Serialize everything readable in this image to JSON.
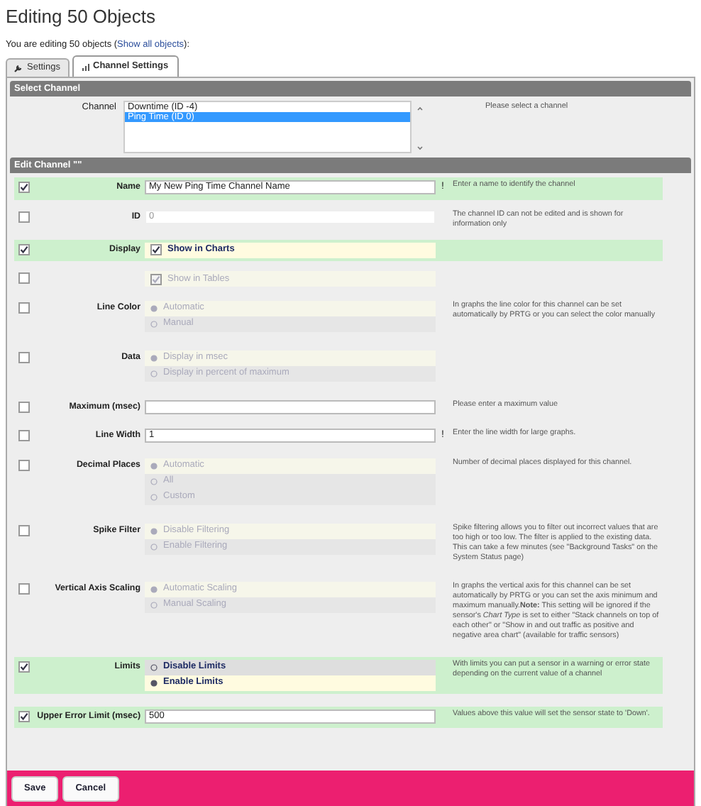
{
  "page_title": "Editing 50 Objects",
  "intro": {
    "before": "You are editing 50 objects (",
    "link": "Show all objects",
    "after": "):"
  },
  "tabs": [
    {
      "label": "Settings",
      "selected": false
    },
    {
      "label": "Channel Settings",
      "selected": true
    }
  ],
  "select_channel": {
    "title": "Select Channel",
    "label": "Channel",
    "help": "Please select a channel",
    "channels": [
      {
        "label": "Downtime (ID -4)",
        "selected": false
      },
      {
        "label": "Ping Time (ID 0)",
        "selected": true
      }
    ]
  },
  "edit_channel": {
    "title": "Edit Channel \"\"",
    "rows": [
      {
        "kind": "text",
        "label": "Name",
        "applied": true,
        "value": "My New Ping Time Channel Name",
        "mark": "!",
        "help": "Enter a name to identify the channel"
      },
      {
        "kind": "readonly",
        "label": "ID",
        "applied": false,
        "value": "0",
        "help": "The channel ID can not be edited and is shown for information only"
      },
      {
        "kind": "checkbox",
        "label": "Display",
        "applied": true,
        "option": "Show in Charts",
        "checked": true
      },
      {
        "kind": "checkbox",
        "applied": false,
        "option": "Show in Tables",
        "checked": true
      },
      {
        "kind": "radio",
        "label": "Line Color",
        "applied": false,
        "help": "In graphs the line color for this channel can be set automatically by PRTG or you can select the color manually",
        "options": [
          {
            "label": "Automatic",
            "selected": true
          },
          {
            "label": "Manual",
            "selected": false
          }
        ]
      },
      {
        "kind": "radio",
        "label": "Data",
        "applied": false,
        "options": [
          {
            "label": "Display in msec",
            "selected": true
          },
          {
            "label": "Display in percent of maximum",
            "selected": false
          }
        ]
      },
      {
        "kind": "text",
        "label": "Maximum (msec)",
        "applied": false,
        "help": "Please enter a maximum value"
      },
      {
        "kind": "text",
        "label": "Line Width",
        "applied": false,
        "value": "1",
        "mark": "!",
        "help": "Enter the line width for large graphs."
      },
      {
        "kind": "radio",
        "label": "Decimal Places",
        "applied": false,
        "help": "Number of decimal places displayed for this channel.",
        "options": [
          {
            "label": "Automatic",
            "selected": true
          },
          {
            "label": "All",
            "selected": false
          },
          {
            "label": "Custom",
            "selected": false
          }
        ]
      },
      {
        "kind": "radio",
        "label": "Spike Filter",
        "applied": false,
        "help": "Spike filtering allows you to filter out incorrect values that are too high or too low. The filter is applied to the existing data. This can take a few minutes (see \"Background Tasks\" on the System Status page)",
        "options": [
          {
            "label": "Disable Filtering",
            "selected": true
          },
          {
            "label": "Enable Filtering",
            "selected": false
          }
        ]
      },
      {
        "kind": "radio",
        "label": "Vertical Axis Scaling",
        "applied": false,
        "help": "In graphs the vertical axis for this channel can be set automatically by PRTG or you can set the axis minimum and maximum manually.**Note:** This setting will be ignored if the sensor's *Chart Type* is set to either \"Stack channels on top of each other\" or \"Show in and out traffic as positive and negative area chart\" (available for traffic sensors)",
        "options": [
          {
            "label": "Automatic Scaling",
            "selected": true
          },
          {
            "label": "Manual Scaling",
            "selected": false
          }
        ]
      },
      {
        "kind": "radio",
        "label": "Limits",
        "applied": true,
        "help": "With limits you can put a sensor in a warning or error state depending on the current value of a channel",
        "options": [
          {
            "label": "Disable Limits",
            "selected": false
          },
          {
            "label": "Enable Limits",
            "selected": true
          }
        ]
      },
      {
        "kind": "text",
        "label": "Upper Error Limit (msec)",
        "applied": true,
        "value": "500",
        "help": "Values above this value will set the sensor state to 'Down'."
      }
    ]
  },
  "buttons": [
    "Save",
    "Cancel"
  ]
}
